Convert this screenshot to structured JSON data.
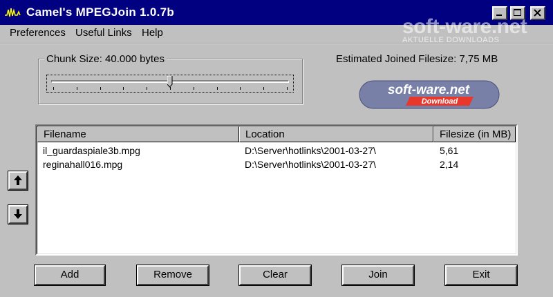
{
  "window": {
    "title": "Camel's MPEGJoin 1.0.7b"
  },
  "watermark": {
    "main": "soft-ware.net",
    "sub": "AKTUELLE DOWNLOADS"
  },
  "menu": {
    "items": [
      "Preferences",
      "Useful Links",
      "Help"
    ]
  },
  "chunk": {
    "label": "Chunk Size: 40.000 bytes",
    "slider_position": 0.5,
    "tick_count": 11
  },
  "estimate": {
    "text": "Estimated Joined Filesize:  7,75 MB"
  },
  "logo": {
    "line1": "soft-ware.net",
    "line2": "Download",
    "colors": {
      "bg": "#7880a8",
      "accent": "#e8382c"
    }
  },
  "list": {
    "columns": [
      "Filename",
      "Location",
      "Filesize (in MB)"
    ],
    "rows": [
      {
        "filename": "il_guardaspiale3b.mpg",
        "location": "D:\\Server\\hotlinks\\2001-03-27\\",
        "size": "5,61"
      },
      {
        "filename": "reginahall016.mpg",
        "location": "D:\\Server\\hotlinks\\2001-03-27\\",
        "size": "2,14"
      }
    ]
  },
  "buttons": {
    "add": "Add",
    "remove": "Remove",
    "clear": "Clear",
    "join": "Join",
    "exit": "Exit"
  },
  "icons": {
    "up": "arrow-up-icon",
    "down": "arrow-down-icon",
    "app": "waveform-icon"
  },
  "colors": {
    "titlebar": "#000080",
    "face": "#c0c0c0"
  }
}
